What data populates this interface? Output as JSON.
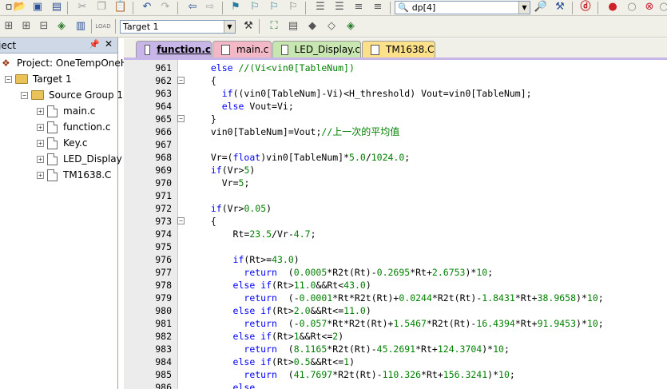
{
  "toolbar": {
    "target_combo": "Target 1",
    "file_combo": "dp[4]"
  },
  "project_pane": {
    "title": "ject",
    "tree": [
      {
        "label": "Project: OneTempOneH",
        "level": 0,
        "kind": "project"
      },
      {
        "label": "Target 1",
        "level": 1,
        "kind": "target"
      },
      {
        "label": "Source Group 1",
        "level": 2,
        "kind": "folder"
      },
      {
        "label": "main.c",
        "level": 3,
        "kind": "file"
      },
      {
        "label": "function.c",
        "level": 3,
        "kind": "file"
      },
      {
        "label": "Key.c",
        "level": 3,
        "kind": "file"
      },
      {
        "label": "LED_Display",
        "level": 3,
        "kind": "file"
      },
      {
        "label": "TM1638.C",
        "level": 3,
        "kind": "file"
      }
    ]
  },
  "tabs": [
    {
      "label": "function.c",
      "color": "#c9b6e8",
      "active": true
    },
    {
      "label": "main.c",
      "color": "#f2b8c6",
      "active": false
    },
    {
      "label": "LED_Display.c",
      "color": "#c8e6b0",
      "active": false
    },
    {
      "label": "TM1638.C",
      "color": "#fde08a",
      "active": false
    }
  ],
  "code_lines": [
    {
      "n": "961",
      "fold": "",
      "code": "  else //(Vi<vin0[TableNum])"
    },
    {
      "n": "962",
      "fold": "-",
      "code": "  {"
    },
    {
      "n": "963",
      "fold": "",
      "code": "    if((vin0[TableNum]-Vi)<H_threshold) Vout=vin0[TableNum];"
    },
    {
      "n": "964",
      "fold": "",
      "code": "    else Vout=Vi;"
    },
    {
      "n": "965",
      "fold": "-",
      "code": "  }"
    },
    {
      "n": "966",
      "fold": "",
      "code": "  vin0[TableNum]=Vout;//上一次的平均值"
    },
    {
      "n": "967",
      "fold": "",
      "code": ""
    },
    {
      "n": "968",
      "fold": "",
      "code": "  Vr=(float)vin0[TableNum]*5.0/1024.0;"
    },
    {
      "n": "969",
      "fold": "",
      "code": "  if(Vr>5)"
    },
    {
      "n": "970",
      "fold": "",
      "code": "    Vr=5;"
    },
    {
      "n": "971",
      "fold": "",
      "code": ""
    },
    {
      "n": "972",
      "fold": "",
      "code": "  if(Vr>0.05)"
    },
    {
      "n": "973",
      "fold": "-",
      "code": "  {"
    },
    {
      "n": "974",
      "fold": "",
      "code": "      Rt=23.5/Vr-4.7;"
    },
    {
      "n": "975",
      "fold": "",
      "code": ""
    },
    {
      "n": "976",
      "fold": "",
      "code": "      if(Rt>=43.0)"
    },
    {
      "n": "977",
      "fold": "",
      "code": "        return  (0.0005*R2t(Rt)-0.2695*Rt+2.6753)*10;"
    },
    {
      "n": "978",
      "fold": "",
      "code": "      else if(Rt>11.0&&Rt<43.0)"
    },
    {
      "n": "979",
      "fold": "",
      "code": "        return  (-0.0001*Rt*R2t(Rt)+0.0244*R2t(Rt)-1.8431*Rt+38.9658)*10;"
    },
    {
      "n": "980",
      "fold": "",
      "code": "      else if(Rt>2.0&&Rt<=11.0)"
    },
    {
      "n": "981",
      "fold": "",
      "code": "        return  (-0.057*Rt*R2t(Rt)+1.5467*R2t(Rt)-16.4394*Rt+91.9453)*10;"
    },
    {
      "n": "982",
      "fold": "",
      "code": "      else if(Rt>1&&Rt<=2)"
    },
    {
      "n": "983",
      "fold": "",
      "code": "        return  (8.1165*R2t(Rt)-45.2691*Rt+124.3704)*10;"
    },
    {
      "n": "984",
      "fold": "",
      "code": "      else if(Rt>0.5&&Rt<=1)"
    },
    {
      "n": "985",
      "fold": "",
      "code": "        return  (41.7697*R2t(Rt)-110.326*Rt+156.3241)*10;"
    },
    {
      "n": "986",
      "fold": "",
      "code": "      else"
    }
  ]
}
